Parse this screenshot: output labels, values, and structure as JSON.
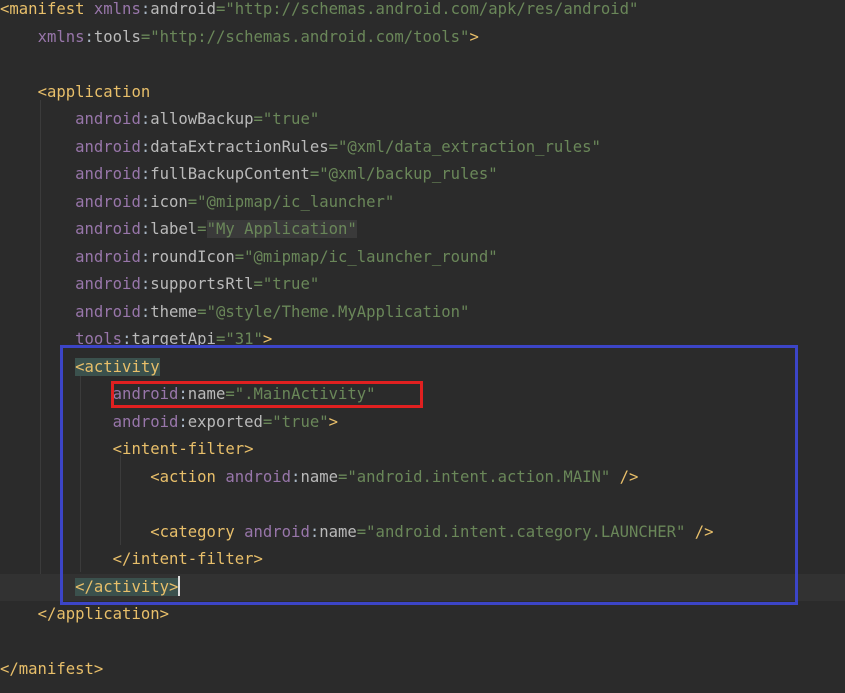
{
  "code_lines": [
    "<manifest xmlns:android=\"http://schemas.android.com/apk/res/android\"",
    "    xmlns:tools=\"http://schemas.android.com/tools\">",
    "",
    "    <application",
    "        android:allowBackup=\"true\"",
    "        android:dataExtractionRules=\"@xml/data_extraction_rules\"",
    "        android:fullBackupContent=\"@xml/backup_rules\"",
    "        android:icon=\"@mipmap/ic_launcher\"",
    "        android:label=\"My Application\"",
    "        android:roundIcon=\"@mipmap/ic_launcher_round\"",
    "        android:supportsRtl=\"true\"",
    "        android:theme=\"@style/Theme.MyApplication\"",
    "        tools:targetApi=\"31\">",
    "        <activity",
    "            android:name=\".MainActivity\"",
    "            android:exported=\"true\">",
    "            <intent-filter>",
    "                <action android:name=\"android.intent.action.MAIN\" />",
    "",
    "                <category android:name=\"android.intent.category.LAUNCHER\" />",
    "            </intent-filter>",
    "        </activity>",
    "    </application>",
    "",
    "</manifest>"
  ],
  "current_line_index": 21,
  "annotations": {
    "blue_box_label": "activity block highlight",
    "red_box_label": "android:name attribute highlight",
    "blue_color": "#3c45c7",
    "red_color": "#e02020"
  },
  "theme": {
    "background": "#2b2b2b",
    "tag_color": "#e8bf6a",
    "namespace_color": "#9876aa",
    "attribute_color": "#bababa",
    "value_color": "#6a8759"
  }
}
